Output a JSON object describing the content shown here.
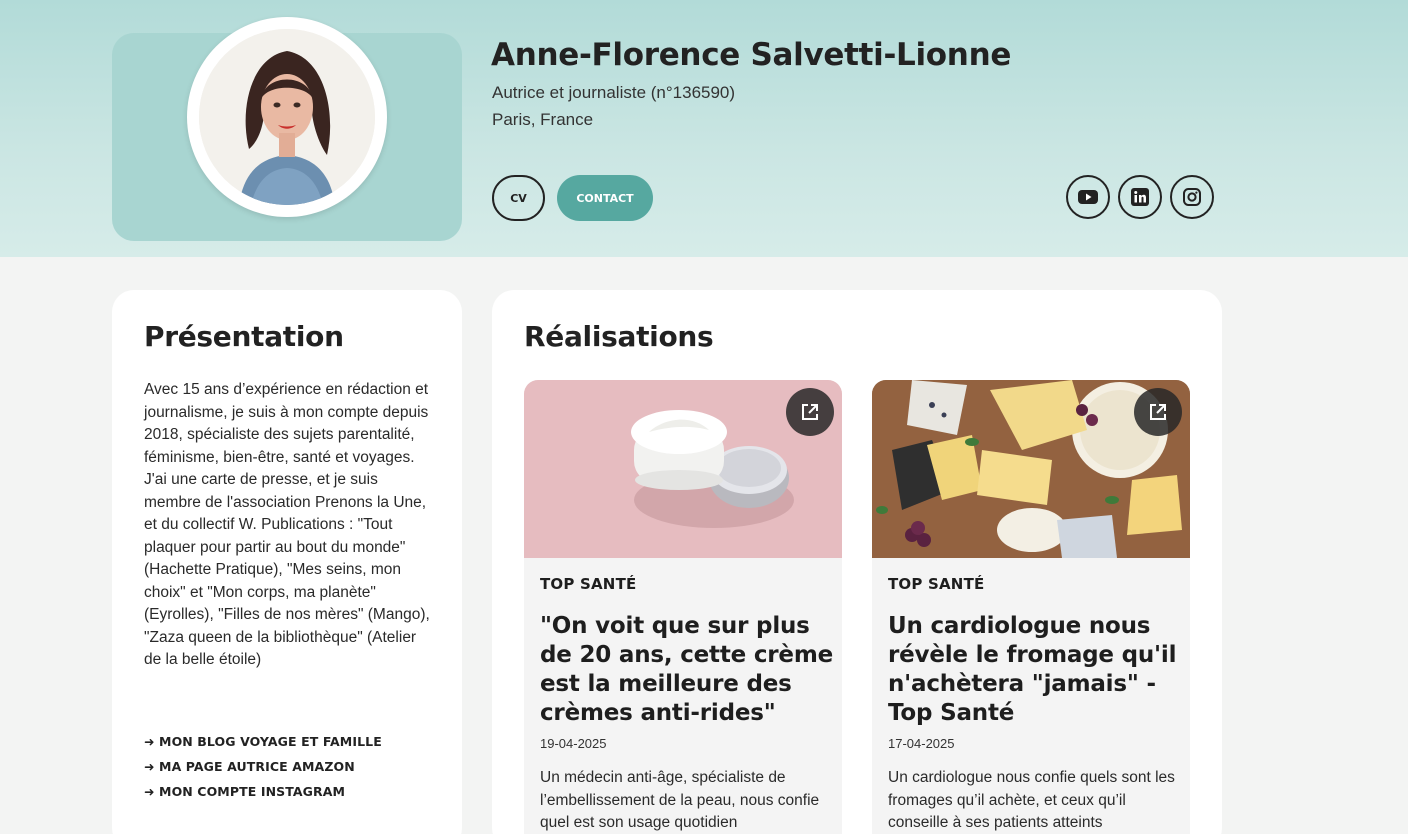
{
  "profile": {
    "name": "Anne-Florence Salvetti-Lionne",
    "subtitle": "Autrice et journaliste (n°136590)",
    "location": "Paris, France",
    "cv_label": "CV",
    "contact_label": "CONTACT"
  },
  "social": [
    {
      "icon": "youtube-icon"
    },
    {
      "icon": "linkedin-icon"
    },
    {
      "icon": "instagram-icon"
    }
  ],
  "presentation": {
    "title": "Présentation",
    "text": "Avec 15 ans d’expérience en rédaction et journalisme, je suis à mon compte depuis 2018, spécialiste des sujets parentalité, féminisme, bien-être, santé et voyages. J'ai une carte de presse, et je suis membre de l'association Prenons la Une, et du collectif W. Publications : \"Tout plaquer pour partir au bout du monde\" (Hachette Pratique), \"Mes seins, mon choix\" et \"Mon corps, ma planète\" (Eyrolles), \"Filles de nos mères\" (Mango), \"Zaza queen de la bibliothèque\" (Atelier de la belle étoile)",
    "links": [
      "➜ MON BLOG VOYAGE ET FAMILLE",
      "➜ MA PAGE AUTRICE AMAZON",
      "➜ MON COMPTE INSTAGRAM"
    ]
  },
  "realisations": {
    "title": "Réalisations",
    "articles": [
      {
        "publication": "TOP SANTÉ",
        "headline": "\"On voit que sur plus de 20 ans, cette crème est la meilleure des crèmes anti-rides\"",
        "date": "19-04-2025",
        "summary": "Un médecin anti-âge, spécialiste de l’embellissement de la peau, nous confie quel est son usage quotidien"
      },
      {
        "publication": "TOP SANTÉ",
        "headline": "Un cardiologue nous révèle le fromage qu'il n'achètera \"jamais\" - Top Santé",
        "date": "17-04-2025",
        "summary": "Un cardiologue nous confie quels sont les fromages qu’il achète, et ceux qu’il conseille à ses patients atteints"
      }
    ]
  },
  "colors": {
    "accent": "#56a8a0",
    "hero_bg": "#b2dbd8",
    "avatar_card": "#a8d5d1"
  }
}
